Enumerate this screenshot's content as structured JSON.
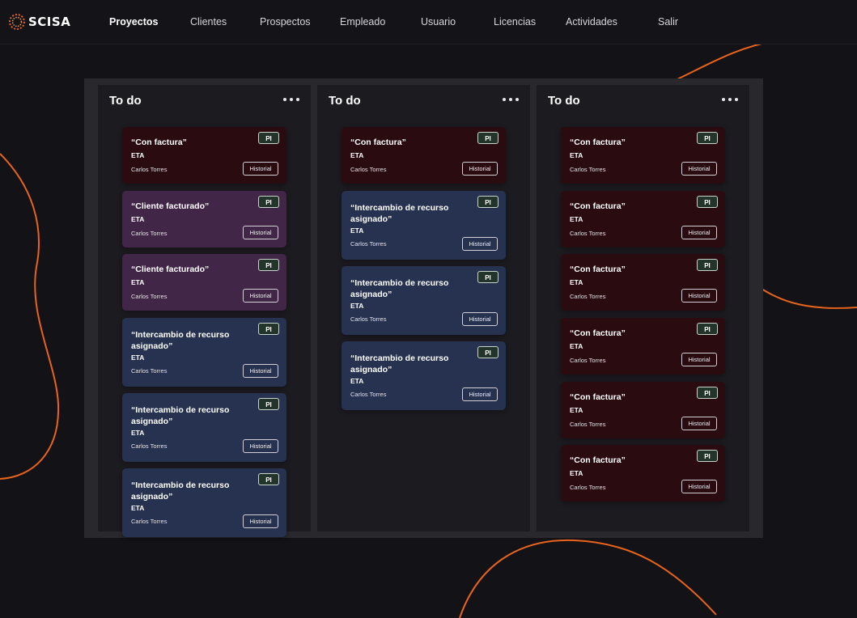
{
  "brand": {
    "name": "SCISA",
    "logo_icon": "scisa-logo-icon"
  },
  "nav": {
    "items": [
      {
        "label": "Proyectos",
        "active": true
      },
      {
        "label": "Clientes",
        "active": false
      },
      {
        "label": "Prospectos",
        "active": false
      },
      {
        "label": "Empleado",
        "active": false
      },
      {
        "label": "Usuario",
        "active": false
      },
      {
        "label": "Licencias",
        "active": false
      },
      {
        "label": "Actividades",
        "active": false
      },
      {
        "label": "Salir",
        "active": false
      }
    ]
  },
  "colors": {
    "background": "#131217",
    "board": "#29282d",
    "column": "#1c1b20",
    "card_red": "#290b10",
    "card_purple": "#412648",
    "card_blue": "#26324f",
    "accent_orange": "#e8641c",
    "badge_green": "#23352b"
  },
  "columns": [
    {
      "title": "To do",
      "menu_icon": "more-horizontal-icon",
      "cards": [
        {
          "title": "“Con factura”",
          "eta": "ETA",
          "person": "Carlos Torres",
          "badge": "PI",
          "button": "Historial",
          "color": "red"
        },
        {
          "title": "“Cliente facturado”",
          "eta": "ETA",
          "person": "Carlos Torres",
          "badge": "PI",
          "button": "Historial",
          "color": "purple"
        },
        {
          "title": "“Cliente facturado”",
          "eta": "ETA",
          "person": "Carlos Torres",
          "badge": "PI",
          "button": "Historial",
          "color": "purple"
        },
        {
          "title": "“Intercambio de recurso asignado”",
          "eta": "ETA",
          "person": "Carlos Torres",
          "badge": "PI",
          "button": "Historial",
          "color": "blue"
        },
        {
          "title": "“Intercambio de recurso asignado”",
          "eta": "ETA",
          "person": "Carlos Torres",
          "badge": "PI",
          "button": "Historial",
          "color": "blue"
        },
        {
          "title": "“Intercambio de recurso asignado”",
          "eta": "ETA",
          "person": "Carlos Torres",
          "badge": "PI",
          "button": "Historial",
          "color": "blue"
        }
      ]
    },
    {
      "title": "To do",
      "menu_icon": "more-horizontal-icon",
      "cards": [
        {
          "title": "“Con factura”",
          "eta": "ETA",
          "person": "Carlos Torres",
          "badge": "PI",
          "button": "Historial",
          "color": "red"
        },
        {
          "title": "“Intercambio de recurso asignado”",
          "eta": "ETA",
          "person": "Carlos Torres",
          "badge": "PI",
          "button": "Historial",
          "color": "blue"
        },
        {
          "title": "“Intercambio de recurso asignado”",
          "eta": "ETA",
          "person": "Carlos Torres",
          "badge": "PI",
          "button": "Historial",
          "color": "blue"
        },
        {
          "title": "“Intercambio de recurso asignado”",
          "eta": "ETA",
          "person": "Carlos Torres",
          "badge": "PI",
          "button": "Historial",
          "color": "blue"
        }
      ]
    },
    {
      "title": "To do",
      "menu_icon": "more-horizontal-icon",
      "cards": [
        {
          "title": "“Con factura”",
          "eta": "ETA",
          "person": "Carlos Torres",
          "badge": "PI",
          "button": "Historial",
          "color": "red"
        },
        {
          "title": "“Con factura”",
          "eta": "ETA",
          "person": "Carlos Torres",
          "badge": "PI",
          "button": "Historial",
          "color": "red"
        },
        {
          "title": "“Con factura”",
          "eta": "ETA",
          "person": "Carlos Torres",
          "badge": "PI",
          "button": "Historial",
          "color": "red"
        },
        {
          "title": "“Con factura”",
          "eta": "ETA",
          "person": "Carlos Torres",
          "badge": "PI",
          "button": "Historial",
          "color": "red"
        },
        {
          "title": "“Con factura”",
          "eta": "ETA",
          "person": "Carlos Torres",
          "badge": "PI",
          "button": "Historial",
          "color": "red"
        },
        {
          "title": "“Con factura”",
          "eta": "ETA",
          "person": "Carlos Torres",
          "badge": "PI",
          "button": "Historial",
          "color": "red"
        }
      ]
    }
  ]
}
